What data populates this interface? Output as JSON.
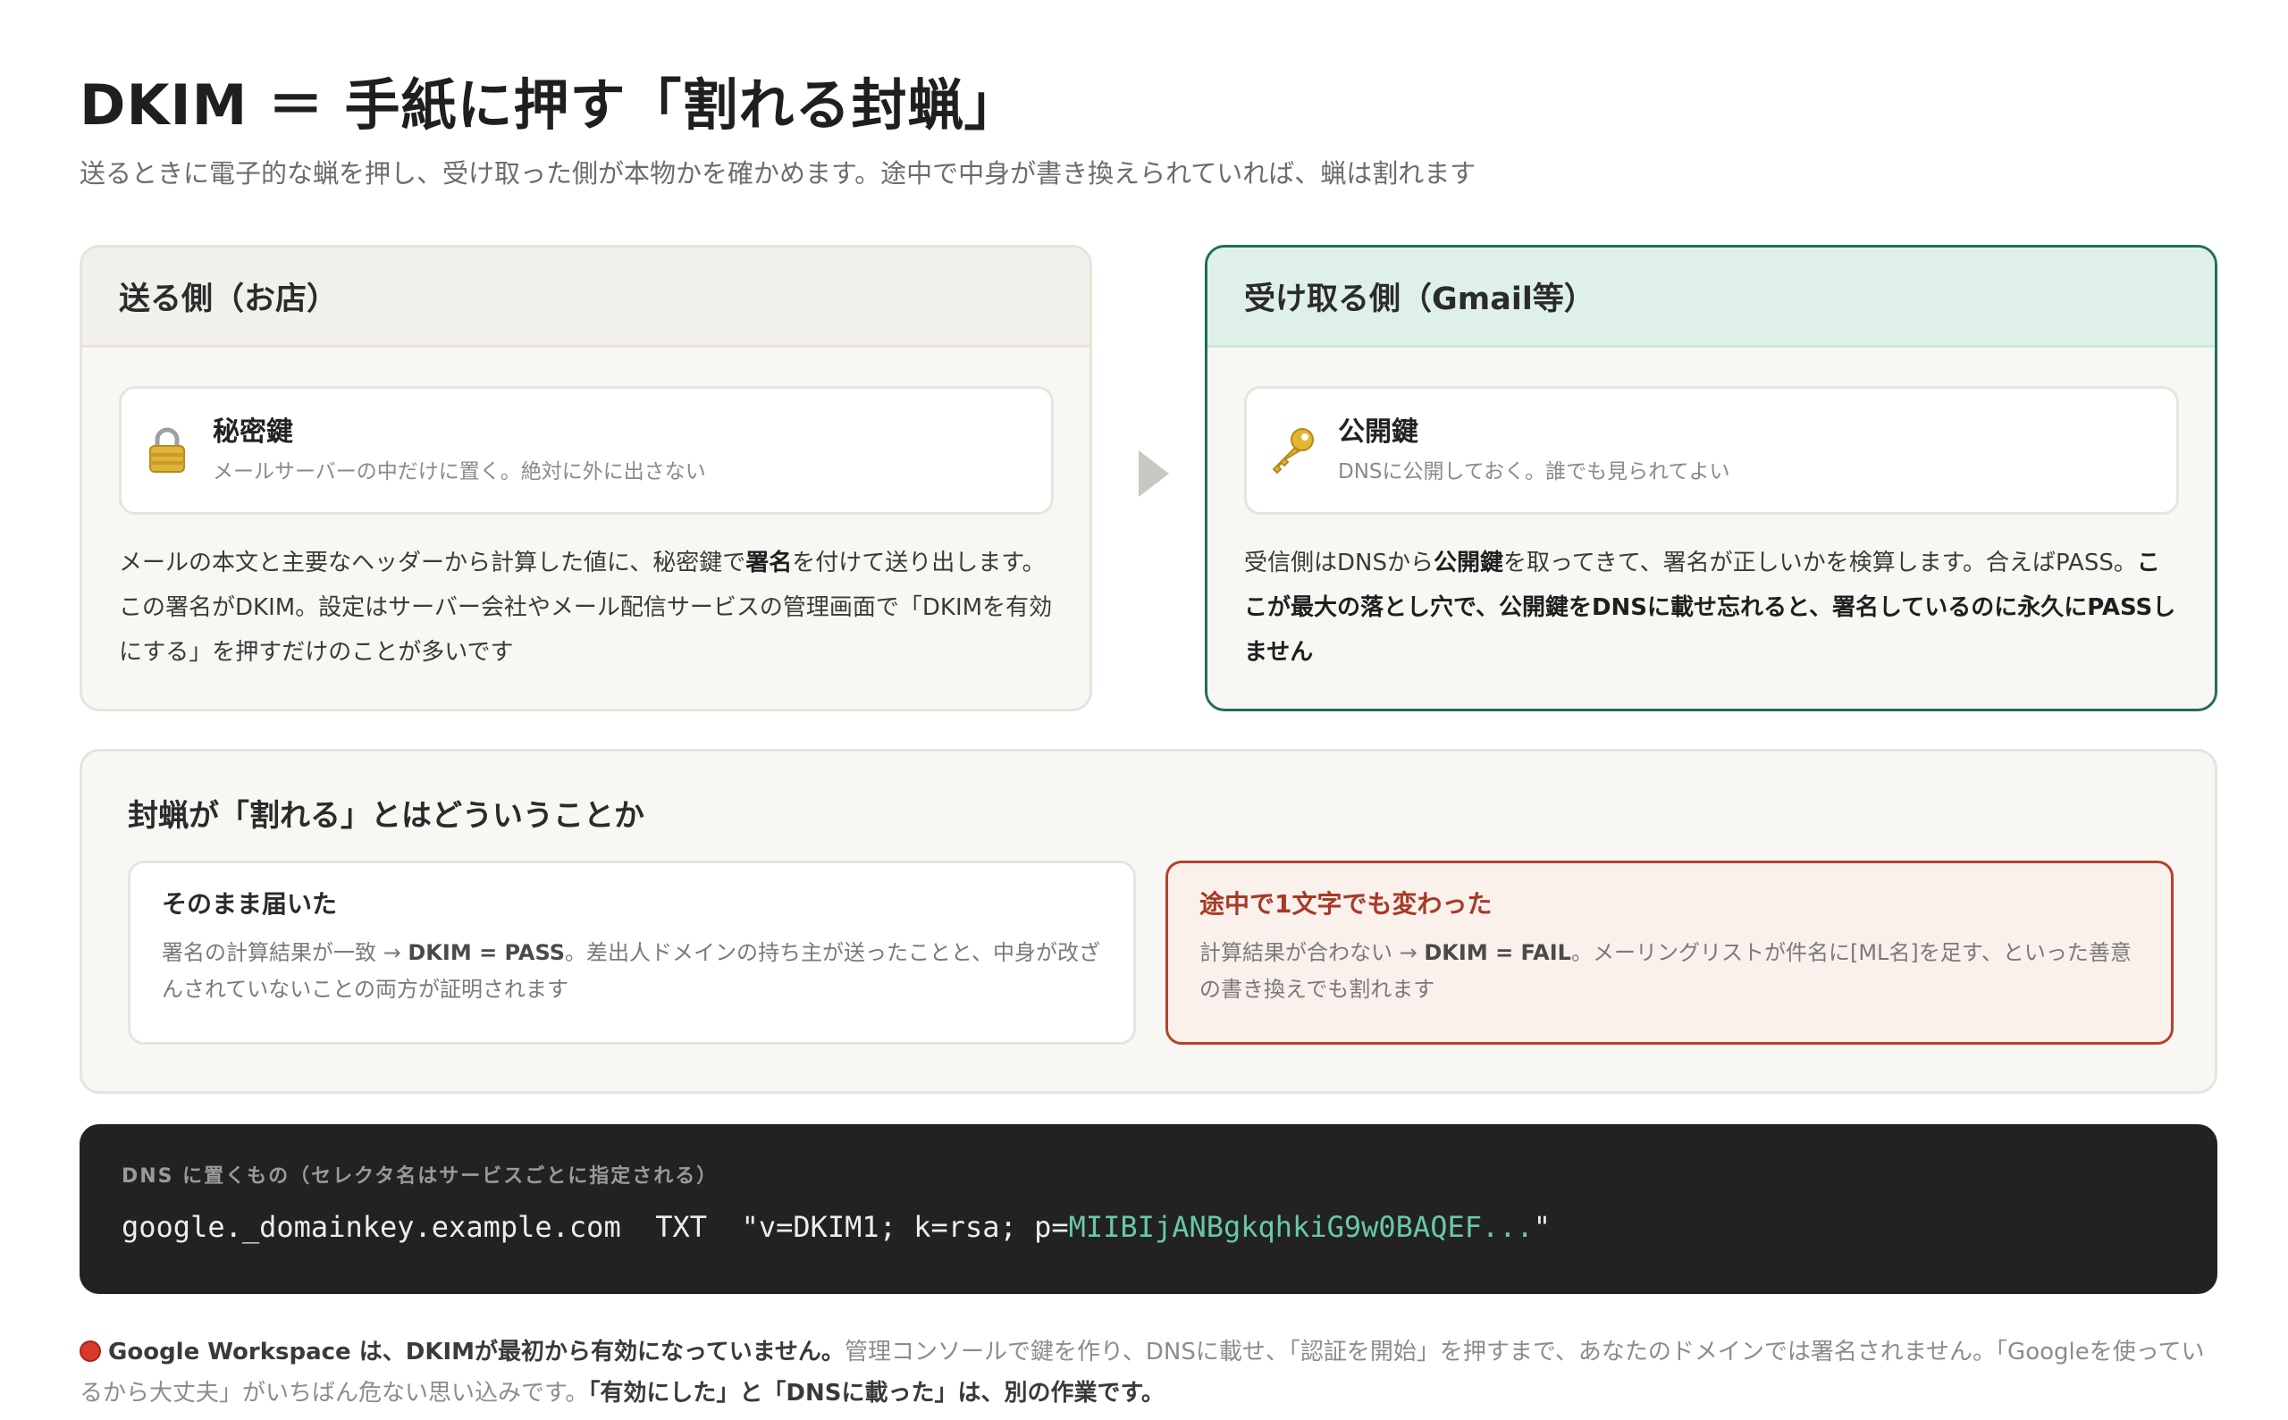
{
  "header": {
    "title": "DKIM ＝ 手紙に押す「割れる封蝋」",
    "subtitle": "送るときに電子的な蝋を押し、受け取った側が本物かを確かめます。途中で中身が書き換えられていれば、蝋は割れます"
  },
  "sender": {
    "heading": "送る側（お店）",
    "key_icon": "lock-icon",
    "key_title": "秘密鍵",
    "key_desc": "メールサーバーの中だけに置く。絶対に外に出さない",
    "body_1": "メールの本文と主要なヘッダーから計算した値に、秘密鍵で",
    "body_bold": "署名",
    "body_2": "を付けて送り出します。この署名がDKIM。設定はサーバー会社やメール配信サービスの管理画面で「DKIMを有効にする」を押すだけのことが多いです"
  },
  "receiver": {
    "heading": "受け取る側（Gmail等）",
    "key_icon": "key-icon",
    "key_title": "公開鍵",
    "key_desc": "DNSに公開しておく。誰でも見られてよい",
    "body_1": "受信側はDNSから",
    "body_bold_1": "公開鍵",
    "body_2": "を取ってきて、署名が正しいかを検算します。合えばPASS。",
    "body_bold_2": "ここが最大の落とし穴で、公開鍵をDNSに載せ忘れると、署名しているのに永久にPASSしません"
  },
  "seal": {
    "title": "封蝋が「割れる」とはどういうことか",
    "ok": {
      "title": "そのまま届いた",
      "text_1": "署名の計算結果が一致 → ",
      "text_bold": "DKIM = PASS",
      "text_2": "。差出人ドメインの持ち主が送ったことと、中身が改ざんされていないことの両方が証明されます"
    },
    "bad": {
      "title": "途中で1文字でも変わった",
      "text_1": "計算結果が合わない → ",
      "text_bold": "DKIM = FAIL",
      "text_2": "。メーリングリストが件名に[ML名]を足す、といった善意の書き換えでも割れます"
    }
  },
  "dns": {
    "label": "DNS に置くもの（セレクタ名はサービスごとに指定される）",
    "record_prefix": "google._domainkey.example.com  TXT  \"v=DKIM1; k=rsa; p=",
    "record_key": "MIIBIjANBgkqhkiG9w0BAQEF...",
    "record_suffix": "\""
  },
  "warning": {
    "icon": "red-circle-icon",
    "bold_1": "Google Workspace は、DKIMが最初から有効になっていません。",
    "text": "管理コンソールで鍵を作り、DNSに載せ、「認証を開始」を押すまで、あなたのドメインでは署名されません。「Googleを使っているから大丈夫」がいちばん危ない思い込みです。",
    "bold_2": "「有効にした」と「DNSに載った」は、別の作業です。"
  },
  "colors": {
    "accent_green": "#1f6e5c",
    "alert_red": "#b7412b",
    "code_key": "#67c9a5"
  }
}
